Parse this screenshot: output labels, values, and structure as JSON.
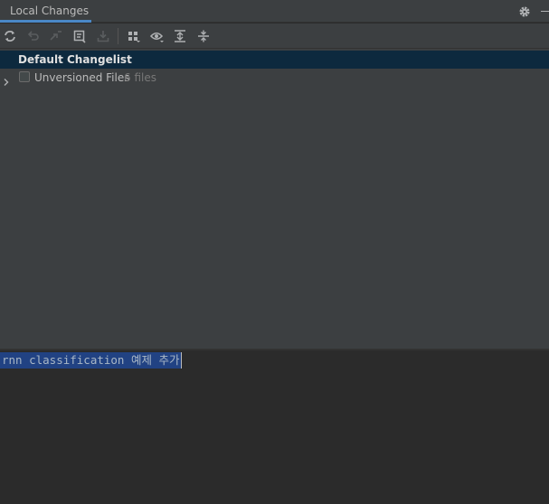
{
  "tabs": {
    "local_changes": "Local Changes"
  },
  "icons": {
    "settings": "gear-icon",
    "minimize": "minimize-icon",
    "refresh": "refresh-icon",
    "rollback": "undo-icon",
    "show_diff": "diff-arrow-icon",
    "shelve": "shelve-icon",
    "update": "download-icon",
    "group_by": "group-by-icon",
    "view_options": "eye-icon",
    "expand_all": "expand-all-icon",
    "collapse_all": "collapse-all-icon",
    "tree_expand": "chevron-right-icon"
  },
  "changelist": {
    "default_name": "Default Changelist",
    "unversioned": {
      "label": "Unversioned Files",
      "count": "6 files"
    }
  },
  "commit": {
    "message": "rnn classification 예제 추가"
  },
  "colors": {
    "accent": "#4a88c7",
    "selected_row": "#0d293e",
    "text_selection": "#214283"
  }
}
